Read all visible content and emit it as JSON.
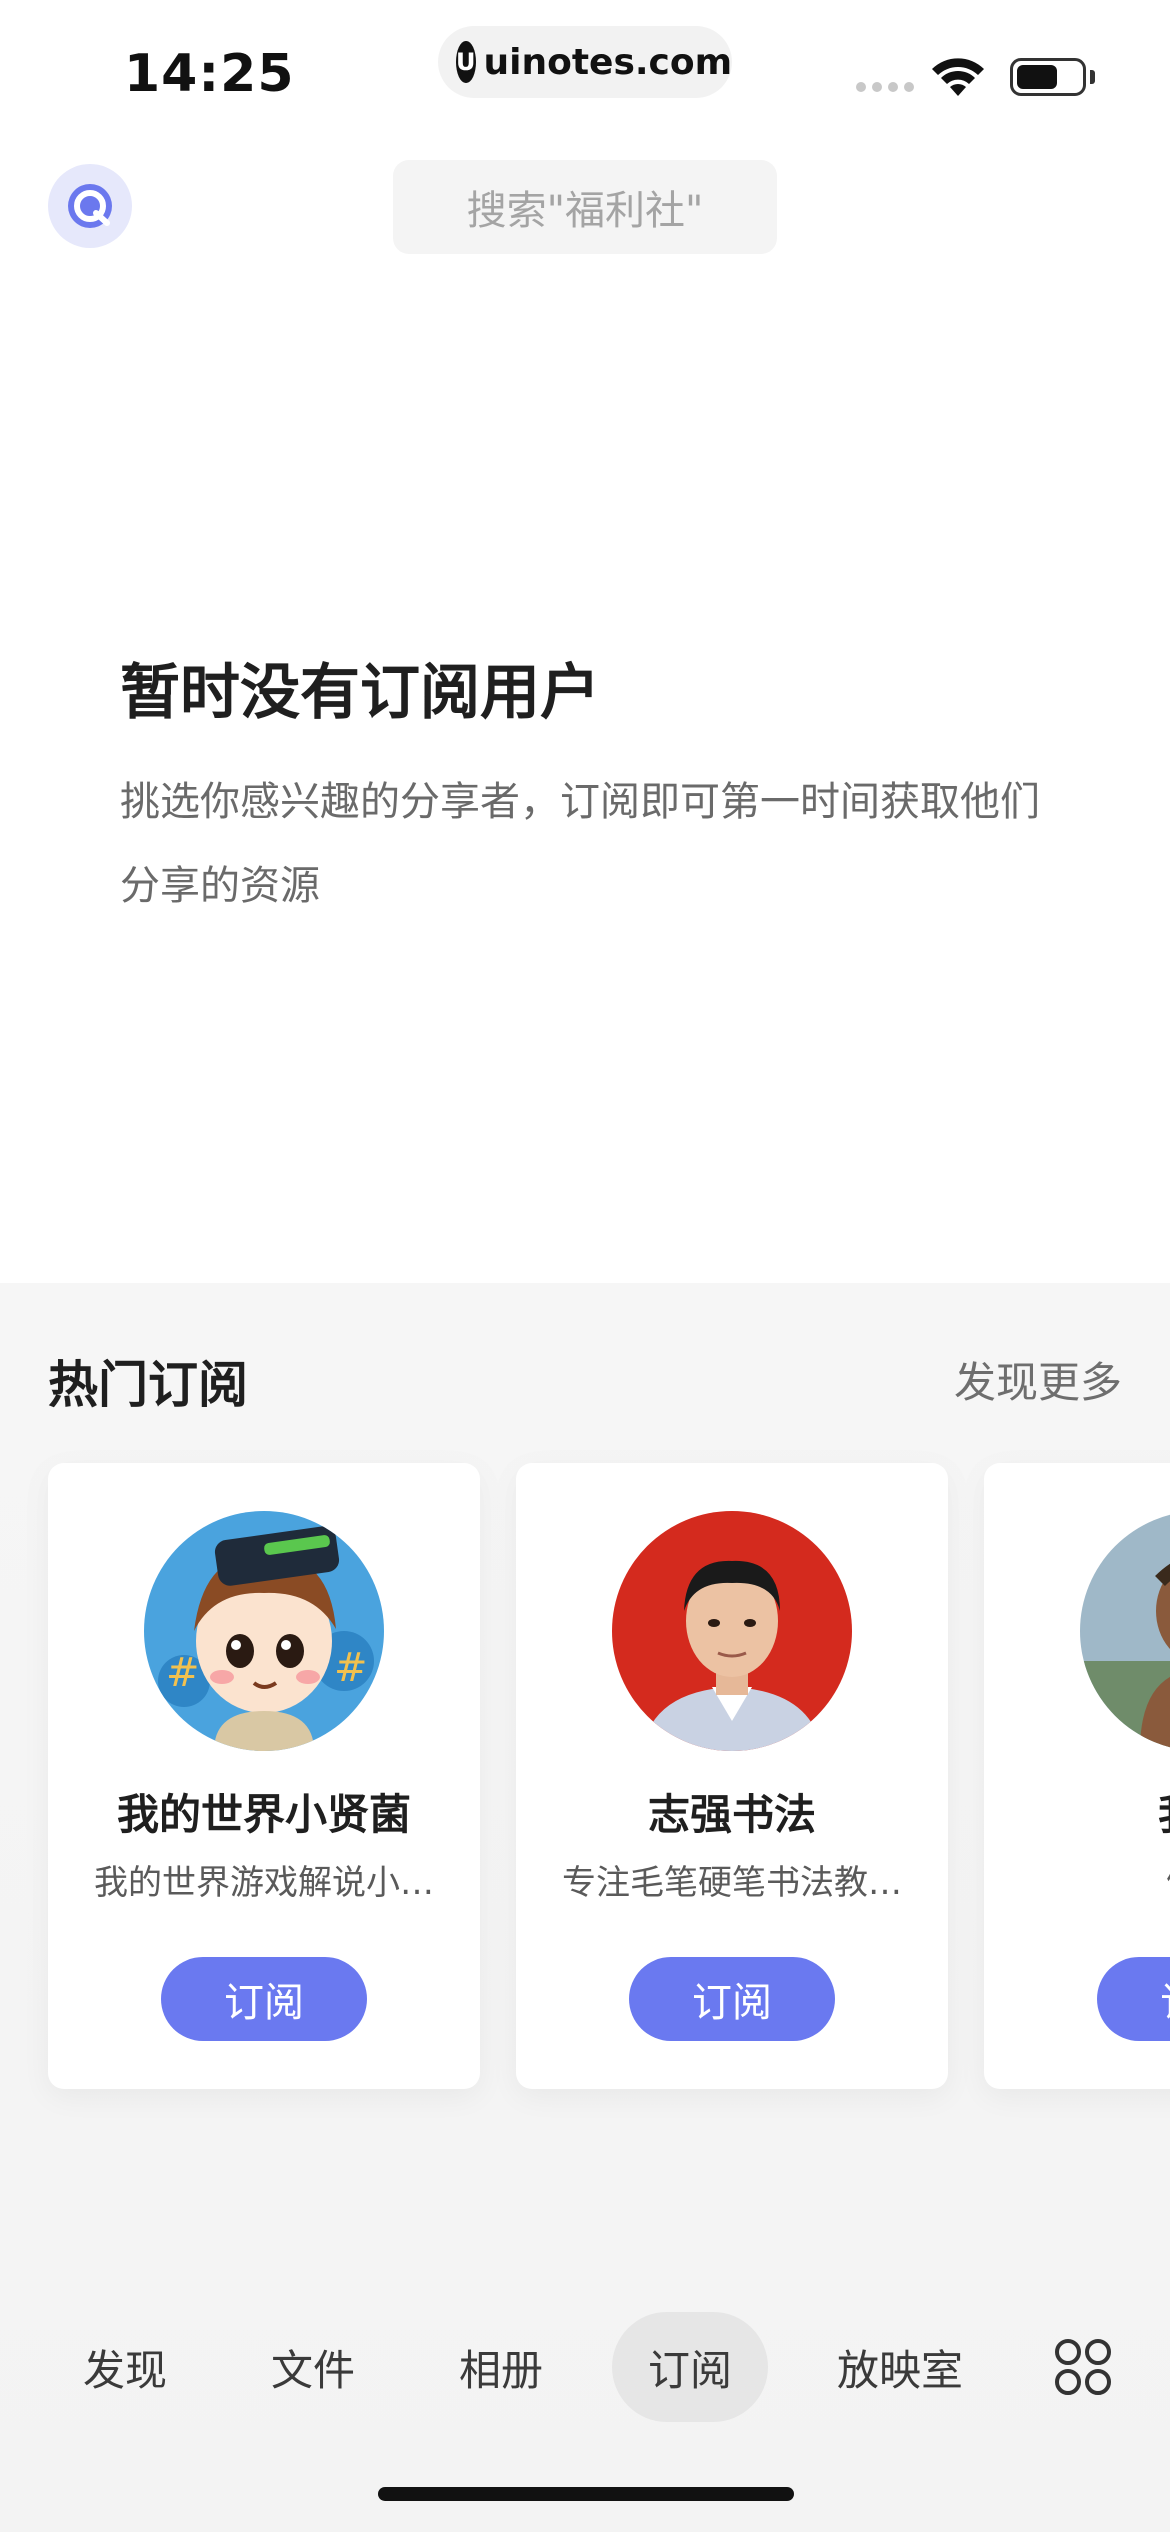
{
  "status_bar": {
    "time": "14:25",
    "url": "uinotes.com",
    "url_logo_letter": "U",
    "battery_level": 0.62
  },
  "top_bar": {
    "logo_icon": "app-logo-icon",
    "search_placeholder": "搜索\"福利社\""
  },
  "empty_state": {
    "title": "暂时没有订阅用户",
    "description": "挑选你感兴趣的分享者，订阅即可第一时间获取他们分享的资源"
  },
  "hot": {
    "title": "热门订阅",
    "more": "发现更多",
    "cards": [
      {
        "name": "我的世界小贤菌",
        "desc": "我的世界游戏解说小…",
        "button": "订阅"
      },
      {
        "name": "志强书法",
        "desc": "专注毛笔硬笔书法教…",
        "button": "订阅"
      },
      {
        "name": "我是",
        "desc": "健身",
        "button": "订阅"
      }
    ]
  },
  "bottom_nav": {
    "items": [
      {
        "label": "发现"
      },
      {
        "label": "文件"
      },
      {
        "label": "相册"
      },
      {
        "label": "订阅"
      },
      {
        "label": "放映室"
      }
    ],
    "active": "订阅",
    "more_icon": "grid-icon"
  },
  "colors": {
    "accent": "#6a79f0",
    "section_bg": "#f4f4f4",
    "active_tab_bg": "#e6e6e6"
  }
}
